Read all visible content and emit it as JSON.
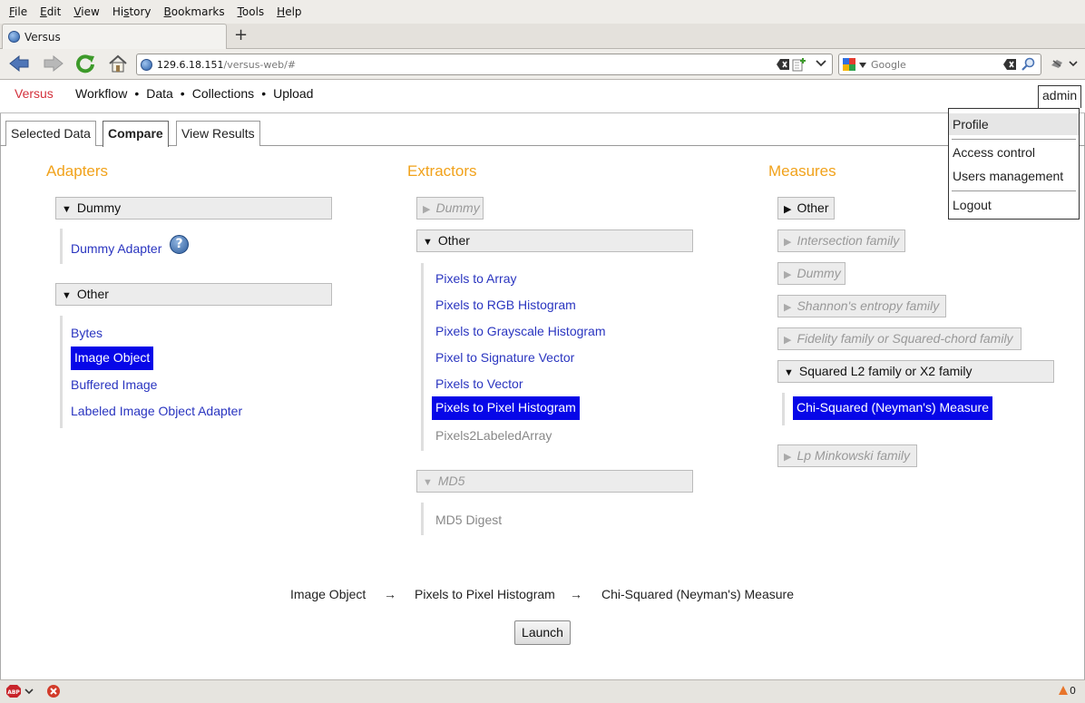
{
  "browser": {
    "menus": [
      {
        "pre": "",
        "ul": "F",
        "post": "ile"
      },
      {
        "pre": "",
        "ul": "E",
        "post": "dit"
      },
      {
        "pre": "",
        "ul": "V",
        "post": "iew"
      },
      {
        "pre": "Hi",
        "ul": "s",
        "post": "tory"
      },
      {
        "pre": "",
        "ul": "B",
        "post": "ookmarks"
      },
      {
        "pre": "",
        "ul": "T",
        "post": "ools"
      },
      {
        "pre": "",
        "ul": "H",
        "post": "elp"
      }
    ],
    "tab_title": "Versus",
    "new_tab": "+",
    "url_host": "129.6.18.151",
    "url_path": "/versus-web/#",
    "search_placeholder": "Google",
    "status_count": "0"
  },
  "app": {
    "brand": "Versus",
    "nav": [
      "Workflow",
      "Data",
      "Collections",
      "Upload"
    ],
    "nav_sep": "•",
    "user": "admin",
    "user_menu": {
      "profile": "Profile",
      "access_control": "Access control",
      "users_management": "Users management",
      "logout": "Logout"
    },
    "tabs": {
      "selected_data": "Selected Data",
      "compare": "Compare",
      "view_results": "View Results"
    }
  },
  "adapters": {
    "title": "Adapters",
    "groups": [
      {
        "name": "Dummy",
        "items": [
          "Dummy Adapter"
        ]
      },
      {
        "name": "Other",
        "items": [
          "Bytes",
          "Image Object",
          "Buffered Image",
          "Labeled Image Object Adapter"
        ]
      }
    ],
    "help": "?"
  },
  "extractors": {
    "title": "Extractors",
    "groups": [
      {
        "name": "Dummy"
      },
      {
        "name": "Other",
        "items": [
          "Pixels to Array",
          "Pixels to RGB Histogram",
          "Pixels to Grayscale Histogram",
          "Pixel to Signature Vector",
          "Pixels to Vector",
          "Pixels to Pixel Histogram",
          "Pixels2LabeledArray"
        ]
      },
      {
        "name": "MD5",
        "items": [
          "MD5 Digest"
        ]
      }
    ]
  },
  "measures": {
    "title": "Measures",
    "groups": [
      {
        "name": "Other"
      },
      {
        "name": "Intersection family"
      },
      {
        "name": "Dummy"
      },
      {
        "name": "Shannon's entropy family"
      },
      {
        "name": "Fidelity family or Squared-chord family"
      },
      {
        "name": "Squared L2 family or X2 family",
        "items": [
          "Chi-Squared (Neyman's) Measure"
        ]
      },
      {
        "name": "Lp Minkowski family"
      }
    ]
  },
  "pipeline": {
    "adapter": "Image Object",
    "extractor": "Pixels to Pixel Histogram",
    "measure": "Chi-Squared (Neyman's) Measure",
    "arrow": "→",
    "launch": "Launch"
  },
  "icons": [
    "back-icon",
    "forward-icon",
    "reload-icon",
    "home-icon",
    "site-globe-icon",
    "clear-icon",
    "rss-icon",
    "dropdown-icon",
    "search-engine-icon",
    "magnifier-icon",
    "addon-icon",
    "help-icon",
    "adblock-icon",
    "stop-icon"
  ]
}
